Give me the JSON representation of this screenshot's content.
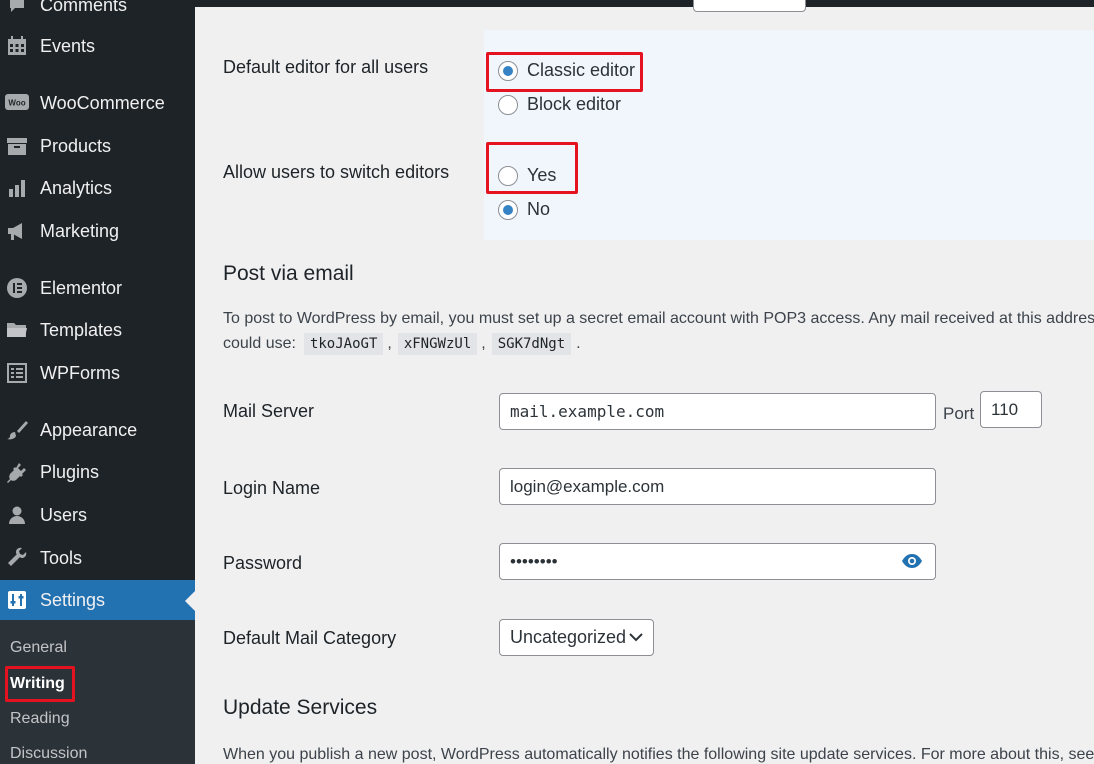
{
  "sidebar": {
    "items": [
      {
        "label": "Comments",
        "icon": "comments-icon"
      },
      {
        "label": "Events",
        "icon": "calendar-icon"
      },
      {
        "label": "WooCommerce",
        "icon": "woocommerce-icon"
      },
      {
        "label": "Products",
        "icon": "archive-box-icon"
      },
      {
        "label": "Analytics",
        "icon": "bar-chart-icon"
      },
      {
        "label": "Marketing",
        "icon": "megaphone-icon"
      },
      {
        "label": "Elementor",
        "icon": "elementor-icon"
      },
      {
        "label": "Templates",
        "icon": "folder-icon"
      },
      {
        "label": "WPForms",
        "icon": "form-icon"
      },
      {
        "label": "Appearance",
        "icon": "paintbrush-icon"
      },
      {
        "label": "Plugins",
        "icon": "plugin-icon"
      },
      {
        "label": "Users",
        "icon": "user-icon"
      },
      {
        "label": "Tools",
        "icon": "wrench-icon"
      },
      {
        "label": "Settings",
        "icon": "settings-icon"
      }
    ],
    "woo_badge": "Woo",
    "submenu": {
      "general": "General",
      "writing": "Writing",
      "reading": "Reading",
      "discussion": "Discussion"
    }
  },
  "editor": {
    "default_label": "Default editor for all users",
    "classic": "Classic editor",
    "block": "Block editor",
    "switch_label": "Allow users to switch editors",
    "yes": "Yes",
    "no": "No",
    "selected_default": "Classic editor",
    "selected_switch": "No"
  },
  "post_via_email": {
    "heading": "Post via email",
    "desc_line1": "To post to WordPress by email, you must set up a secret email account with POP3 access. Any mail received at this address",
    "desc_line2_prefix": "could use:",
    "codes": [
      "tkoJAoGT",
      "xFNGWzUl",
      "SGK7dNgt"
    ],
    "sep": ",",
    "end": ".",
    "mail_server_label": "Mail Server",
    "mail_server_value": "mail.example.com",
    "port_label": "Port",
    "port_value": "110",
    "login_label": "Login Name",
    "login_value": "login@example.com",
    "password_label": "Password",
    "password_value": "••••••••",
    "category_label": "Default Mail Category",
    "category_value": "Uncategorized"
  },
  "update_services": {
    "heading": "Update Services",
    "desc": "When you publish a new post, WordPress automatically notifies the following site update services. For more about this, see"
  },
  "colors": {
    "sidebar_bg": "#1d2327",
    "active_bg": "#2271b1",
    "highlight_box": "#e5121f",
    "radio_checked": "#3582c4"
  }
}
